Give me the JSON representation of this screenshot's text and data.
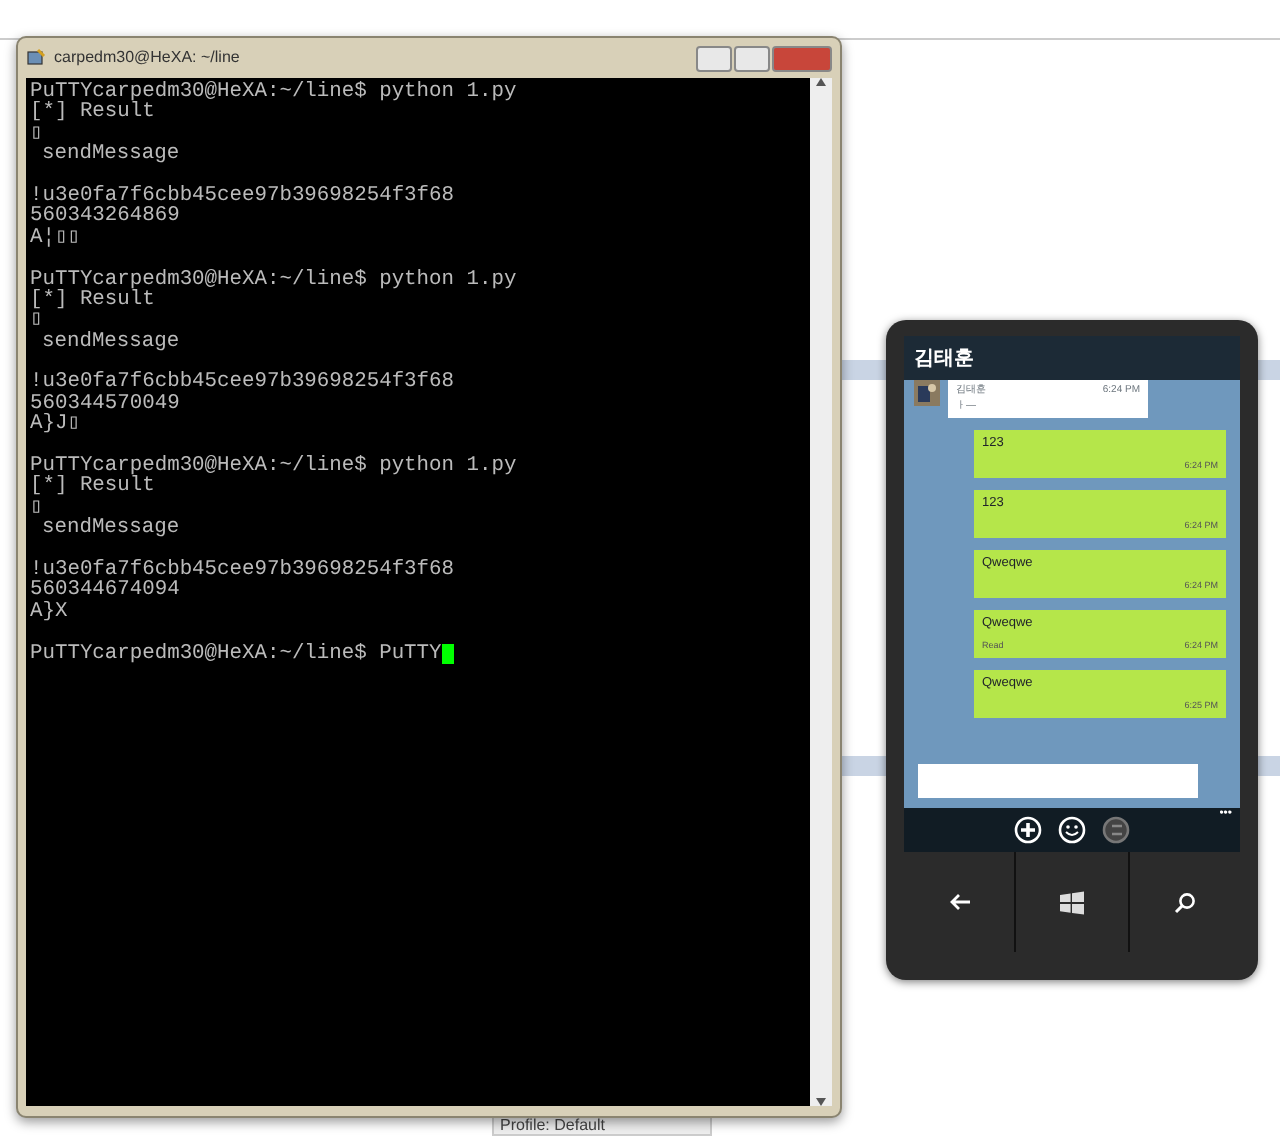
{
  "putty": {
    "title": "carpedm30@HeXA: ~/line",
    "blocks": [
      {
        "prompt": "PuTTYcarpedm30@HeXA:~/line$ python 1.py",
        "result_lines": [
          "[*] Result",
          "▯",
          "sendMessage"
        ],
        "data_lines": [
          "!u3e0fa7f6cbb45cee97b39698254f3f68",
          "560343264869",
          "A¦▯▯"
        ]
      },
      {
        "prompt": "PuTTYcarpedm30@HeXA:~/line$ python 1.py",
        "result_lines": [
          "[*] Result",
          "▯",
          "sendMessage"
        ],
        "data_lines": [
          "!u3e0fa7f6cbb45cee97b39698254f3f68",
          "560344570049",
          "A}J▯"
        ]
      },
      {
        "prompt": "PuTTYcarpedm30@HeXA:~/line$ python 1.py",
        "result_lines": [
          "[*] Result",
          "▯",
          "sendMessage"
        ],
        "data_lines": [
          "!u3e0fa7f6cbb45cee97b39698254f3f68",
          "560344674094",
          "A}X"
        ]
      }
    ],
    "last_prompt": "PuTTYcarpedm30@HeXA:~/line$ PuTTY",
    "cursor": true
  },
  "phone": {
    "chat_title": "김태훈",
    "incoming": {
      "sender": "김태훈",
      "text": "ㅏ—",
      "time": "6:24 PM"
    },
    "outgoing": [
      {
        "text": "123",
        "time": "6:24 PM"
      },
      {
        "text": "123",
        "time": "6:24 PM"
      },
      {
        "text": "Qweqwe",
        "time": "6:24 PM"
      },
      {
        "text": "Qweqwe",
        "time": "6:24 PM",
        "status": "Read"
      },
      {
        "text": "Qweqwe",
        "time": "6:25 PM"
      }
    ],
    "more": "•••"
  },
  "background": {
    "status_text": "Profile: Default"
  }
}
